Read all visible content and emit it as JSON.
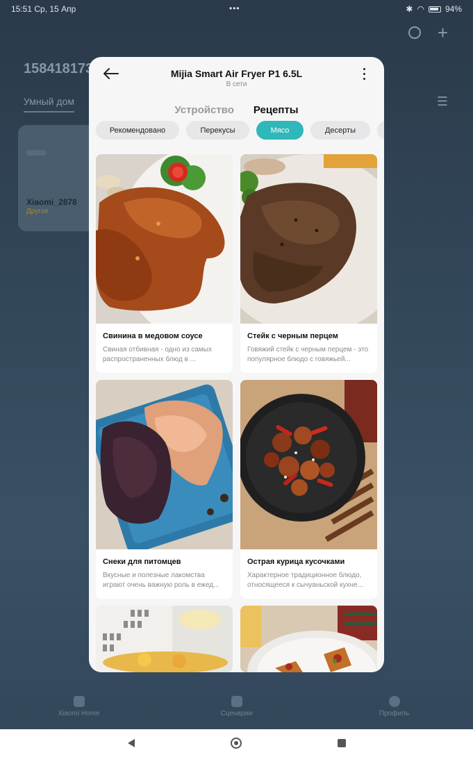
{
  "status_bar": {
    "time": "15:51",
    "date": "Ср, 15 Апр",
    "dots": "•••",
    "battery": "94%"
  },
  "background": {
    "account_id": "158418173",
    "tab": "Умный дом",
    "device_card": {
      "name": "Xiaomi_2878",
      "subtitle": "Другое"
    },
    "bottom_nav": [
      "Xiaomi Home",
      "Сценарии",
      "Профиль"
    ]
  },
  "modal": {
    "title": "Mijia Smart Air Fryer P1 6.5L",
    "subtitle": "В сети",
    "tabs": [
      "Устройство",
      "Рецепты"
    ],
    "active_tab": 1,
    "chips": [
      "Рекомендовано",
      "Перекусы",
      "Мясо",
      "Десерты",
      ""
    ],
    "active_chip": 2,
    "recipes": [
      {
        "title": "Свинина в медовом соусе",
        "desc": "Свиная отбивная - одно из самых распространенных блюд в ..."
      },
      {
        "title": "Стейк с черным перцем",
        "desc": "Говяжий стейк с черным перцем - это популярное блюдо с говяжьей..."
      },
      {
        "title": "Снеки для питомцев",
        "desc": "Вкусные и полезные лакомства играют очень важную роль в ежед..."
      },
      {
        "title": "Острая курица кусочками",
        "desc": "Характерное традиционное блюдо, относящееся к сычуаньской кухне..."
      }
    ]
  }
}
